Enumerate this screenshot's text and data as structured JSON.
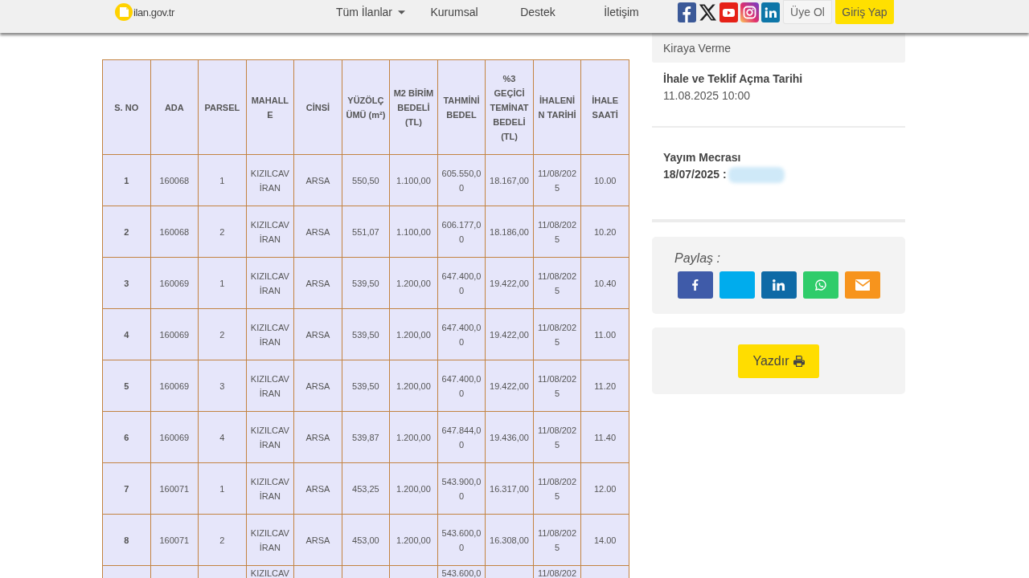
{
  "header": {
    "logo": {
      "text": "ilan.gov.tr"
    },
    "nav": [
      {
        "label": "Tüm İlanlar",
        "dropdown": true
      },
      {
        "label": "Kurumsal",
        "dropdown": false
      },
      {
        "label": "Destek",
        "dropdown": false
      },
      {
        "label": "İletişim",
        "dropdown": false
      }
    ],
    "social_links": [
      {
        "kind": "facebook"
      },
      {
        "kind": "x"
      },
      {
        "kind": "youtube"
      },
      {
        "kind": "instagram"
      },
      {
        "kind": "linkedin"
      }
    ],
    "buttons": [
      {
        "label": "Üye Ol",
        "kind": "secondary"
      },
      {
        "label": "Giriş Yap",
        "kind": "primary"
      }
    ]
  },
  "table": {
    "columns": [
      "S. NO",
      "ADA",
      "PARSEL",
      "MAHALLE",
      "CİNSİ",
      "YÜZÖLÇÜMÜ (m²)",
      "M2 BİRİM BEDELİ (TL)",
      "TAHMİNİ BEDEL",
      "%3 GEÇİCİ TEMİNAT BEDELİ (TL)",
      "İHALENİN TARİHİ",
      "İHALE SAATİ"
    ],
    "rows": [
      [
        "1",
        "160068",
        "1",
        "KIZILCAVİRAN",
        "ARSA",
        "550,50",
        "1.100,00",
        "605.550,00",
        "18.167,00",
        "11/08/2025",
        "10.00"
      ],
      [
        "2",
        "160068",
        "2",
        "KIZILCAVİRAN",
        "ARSA",
        "551,07",
        "1.100,00",
        "606.177,00",
        "18.186,00",
        "11/08/2025",
        "10.20"
      ],
      [
        "3",
        "160069",
        "1",
        "KIZILCAVİRAN",
        "ARSA",
        "539,50",
        "1.200,00",
        "647.400,00",
        "19.422,00",
        "11/08/2025",
        "10.40"
      ],
      [
        "4",
        "160069",
        "2",
        "KIZILCAVİRAN",
        "ARSA",
        "539,50",
        "1.200,00",
        "647.400,00",
        "19.422,00",
        "11/08/2025",
        "11.00"
      ],
      [
        "5",
        "160069",
        "3",
        "KIZILCAVİRAN",
        "ARSA",
        "539,50",
        "1.200,00",
        "647.400,00",
        "19.422,00",
        "11/08/2025",
        "11.20"
      ],
      [
        "6",
        "160069",
        "4",
        "KIZILCAVİRAN",
        "ARSA",
        "539,87",
        "1.200,00",
        "647.844,00",
        "19.436,00",
        "11/08/2025",
        "11.40"
      ],
      [
        "7",
        "160071",
        "1",
        "KIZILCAVİRAN",
        "ARSA",
        "453,25",
        "1.200,00",
        "543.900,00",
        "16.317,00",
        "11/08/2025",
        "12.00"
      ],
      [
        "8",
        "160071",
        "2",
        "KIZILCAVİRAN",
        "ARSA",
        "453,00",
        "1.200,00",
        "543.600,00",
        "16.308,00",
        "11/08/2025",
        "14.00"
      ],
      [
        null,
        null,
        null,
        "KIZILCAV",
        null,
        null,
        null,
        "543.600,0",
        null,
        "11/08/202",
        null
      ]
    ]
  },
  "sidebar": {
    "category": "Kiraya Verme",
    "details": [
      {
        "label": "İhale ve Teklif Açma Tarihi",
        "value": "11.08.2025 10:00",
        "bold": false,
        "blurred": false
      },
      {
        "label": "Yayım Mecrası",
        "value": "18/07/2025 :",
        "bold": true,
        "blurred": true
      }
    ],
    "share": {
      "label": "Paylaş :",
      "buttons": [
        {
          "kind": "facebook"
        },
        {
          "kind": "twitter"
        },
        {
          "kind": "linkedin"
        },
        {
          "kind": "whatsapp"
        },
        {
          "kind": "email"
        }
      ]
    },
    "print_button": {
      "label": "Yazdır"
    }
  }
}
